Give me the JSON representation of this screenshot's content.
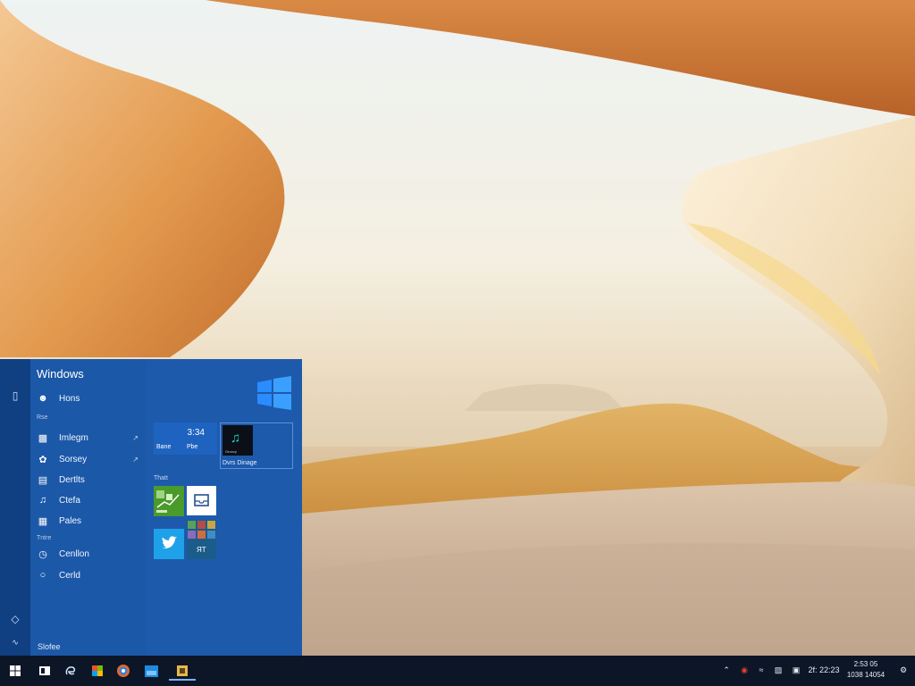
{
  "wallpaper": {
    "name": "desert-abstract"
  },
  "start_menu": {
    "title": "Windows",
    "items": [
      {
        "label": "Hons",
        "icon": "user-icon"
      },
      {
        "label": "Imlegm",
        "icon": "photos-icon",
        "has_arrow": true
      },
      {
        "label": "Sorsey",
        "icon": "gear-icon",
        "has_arrow": true
      },
      {
        "label": "Dertlts",
        "icon": "documents-icon"
      },
      {
        "label": "Ctefa",
        "icon": "music-icon"
      },
      {
        "label": "Pales",
        "icon": "pictures-icon"
      },
      {
        "label": "Cenllon",
        "icon": "clock-icon"
      },
      {
        "label": "Cerld",
        "icon": "chat-icon"
      }
    ],
    "section_1": "Rse",
    "section_2": "Tntre",
    "footer": "Slofee",
    "tiles": {
      "weather_num": "3:34",
      "weather_a": "Bane",
      "weather_b": "Pbe",
      "music_mini": "Groovy",
      "group_label": "Dvrs Dinage",
      "section_head": "Thatt",
      "multi_label": "ЯТ"
    }
  },
  "taskbar": {
    "apps": [
      "start-icon",
      "file-explorer-icon",
      "edge-icon",
      "store-icon",
      "browser-icon",
      "photos-icon",
      "app-icon"
    ],
    "tray": [
      "chevron-up-icon",
      "antivirus-icon",
      "network-icon",
      "keyboard-icon"
    ],
    "tray_time": "2f: 22:23",
    "clock_line1": "2:53 05",
    "clock_line2": "1038 14054"
  },
  "colors": {
    "accent": "#1d5aab",
    "rail": "#103f82",
    "taskbar": "#0c1627"
  }
}
